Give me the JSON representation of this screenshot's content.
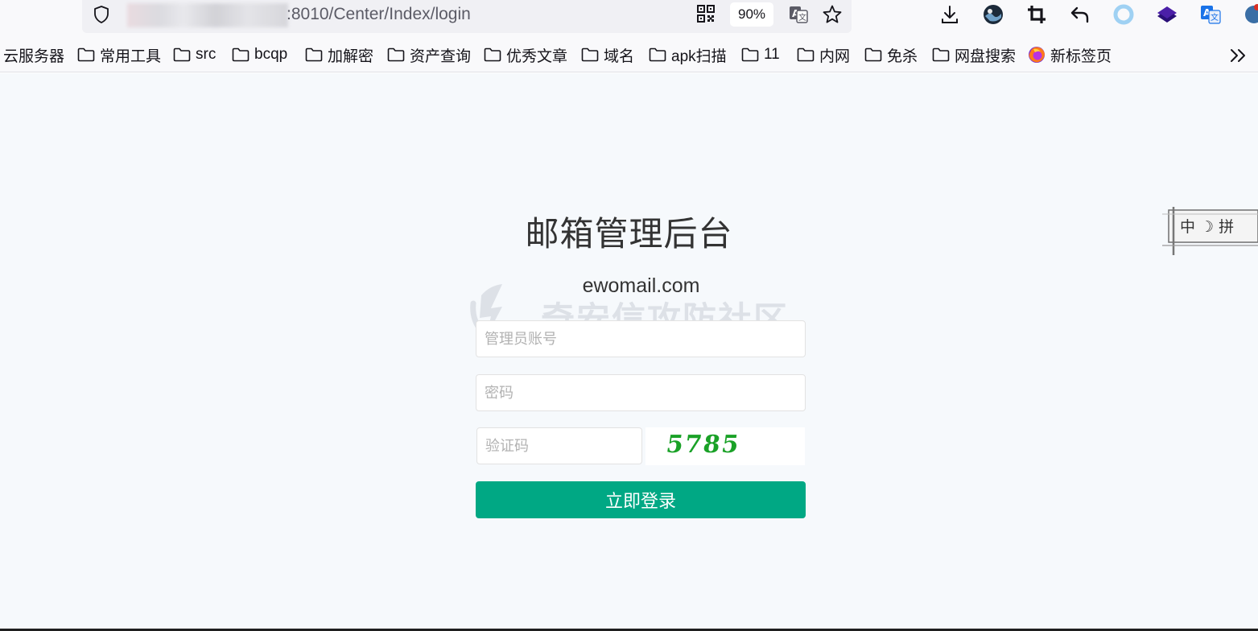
{
  "browser": {
    "url_visible": ":8010/Center/Index/login",
    "zoom": "90%"
  },
  "bookmarks": [
    {
      "label": "云服务器",
      "icon": "none"
    },
    {
      "label": "常用工具",
      "icon": "folder-icon"
    },
    {
      "label": "src",
      "icon": "folder-icon"
    },
    {
      "label": "bcqp",
      "icon": "folder-icon"
    },
    {
      "label": "加解密",
      "icon": "folder-icon"
    },
    {
      "label": "资产查询",
      "icon": "folder-icon"
    },
    {
      "label": "优秀文章",
      "icon": "folder-icon"
    },
    {
      "label": "域名",
      "icon": "folder-icon"
    },
    {
      "label": "apk扫描",
      "icon": "folder-icon"
    },
    {
      "label": "11",
      "icon": "folder-icon"
    },
    {
      "label": "内网",
      "icon": "folder-icon"
    },
    {
      "label": "免杀",
      "icon": "folder-icon"
    },
    {
      "label": "网盘搜索",
      "icon": "folder-icon"
    },
    {
      "label": "新标签页",
      "icon": "firefox-icon"
    }
  ],
  "login": {
    "title": "邮箱管理后台",
    "domain": "ewomail.com",
    "username_placeholder": "管理员账号",
    "password_placeholder": "密码",
    "captcha_placeholder": "验证码",
    "captcha_code": "5785",
    "submit_label": "立即登录"
  },
  "watermark": {
    "text": "奇安信攻防社区"
  },
  "ime": {
    "label": "中 ☽ 拼"
  },
  "colors": {
    "accent": "#00a884",
    "page_bg": "#f6f9fc",
    "captcha": "#1aa127"
  }
}
